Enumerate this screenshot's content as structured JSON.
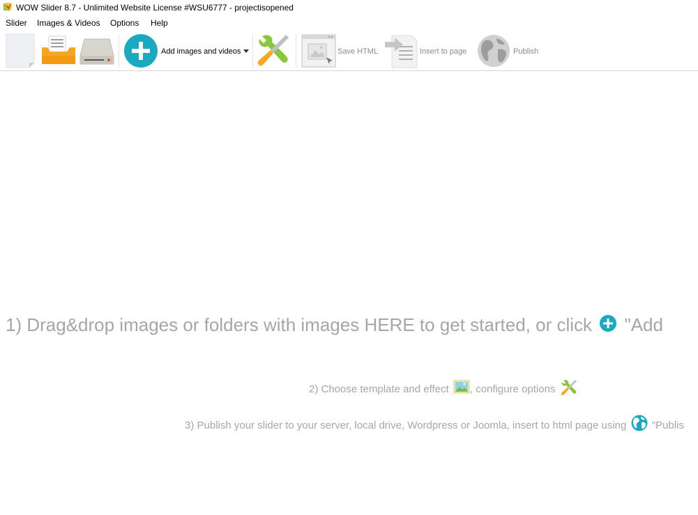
{
  "window": {
    "title": "WOW Slider 8.7 - Unlimited Website License #WSU6777 - projectisopened",
    "app_icon": "wow-slider-icon"
  },
  "menu": {
    "items": [
      {
        "label": "Slider"
      },
      {
        "label": "Images & Videos"
      },
      {
        "label": "Options"
      },
      {
        "label": "Help"
      }
    ]
  },
  "toolbar": {
    "new_icon": "new-document-icon",
    "open_icon": "open-folder-icon",
    "save_icon": "save-drive-icon",
    "add_label": "Add images and videos",
    "add_icon": "plus-circle-icon",
    "dropdown_icon": "dropdown-arrow-icon",
    "settings_icon": "wrench-screwdriver-icon",
    "save_html_label": "Save HTML",
    "save_html_icon": "browser-image-icon",
    "insert_label": "Insert to page",
    "insert_icon": "insert-page-icon",
    "publish_label": "Publish",
    "publish_icon": "globe-icon"
  },
  "hints": {
    "step1_text": "1) Drag&drop images or folders with images HERE to get started, or click",
    "step1_suffix": "\"Add",
    "step2_text": "2) Choose template and effect",
    "step2_suffix": ", configure options",
    "step3_text": "3) Publish your slider to your server, local drive, Wordpress or Joomla, insert to html page using",
    "step3_suffix": "\"Publis"
  },
  "colors": {
    "accent_teal": "#1ba9c1",
    "folder_orange": "#f5a623",
    "hint_gray": "#a6a6a6",
    "disabled_gray": "#8a8a8a"
  }
}
